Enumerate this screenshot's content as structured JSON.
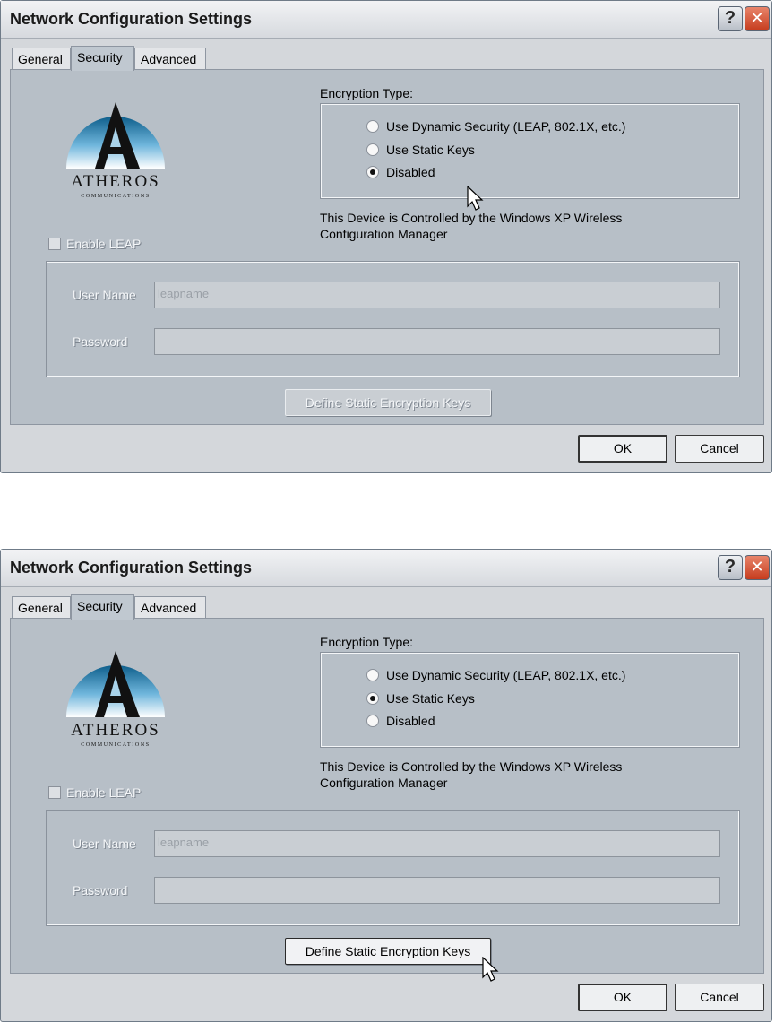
{
  "dialogs": [
    {
      "title": "Network Configuration Settings",
      "tabs": [
        "General",
        "Security",
        "Advanced"
      ],
      "active_tab": "Security",
      "logo": {
        "name": "ATHEROS",
        "mark": "A",
        "sub": "COMMUNICATIONS"
      },
      "encryption_label": "Encryption Type:",
      "options": [
        "Use Dynamic Security (LEAP, 802.1X, etc.)",
        "Use Static Keys",
        "Disabled"
      ],
      "selected_option": "Disabled",
      "device_note": "This Device is Controlled by the Windows XP Wireless Configuration Manager",
      "enable_leap_label": "Enable LEAP",
      "enable_leap_checked": false,
      "user_name_label": "User Name",
      "user_name_value": "leapname",
      "password_label": "Password",
      "password_value": "",
      "define_keys_label": "Define Static Encryption Keys",
      "define_keys_enabled": false,
      "ok_label": "OK",
      "cancel_label": "Cancel"
    },
    {
      "title": "Network Configuration Settings",
      "tabs": [
        "General",
        "Security",
        "Advanced"
      ],
      "active_tab": "Security",
      "logo": {
        "name": "ATHEROS",
        "mark": "A",
        "sub": "COMMUNICATIONS"
      },
      "encryption_label": "Encryption Type:",
      "options": [
        "Use Dynamic Security (LEAP, 802.1X, etc.)",
        "Use Static Keys",
        "Disabled"
      ],
      "selected_option": "Use Static Keys",
      "device_note": "This Device is Controlled by the Windows XP Wireless Configuration Manager",
      "enable_leap_label": "Enable LEAP",
      "enable_leap_checked": false,
      "user_name_label": "User Name",
      "user_name_value": "leapname",
      "password_label": "Password",
      "password_value": "",
      "define_keys_label": "Define Static Encryption Keys",
      "define_keys_enabled": true,
      "ok_label": "OK",
      "cancel_label": "Cancel"
    }
  ],
  "icons": {
    "help": "question-mark-icon",
    "close": "close-icon",
    "cursor": "mouse-pointer-icon"
  }
}
